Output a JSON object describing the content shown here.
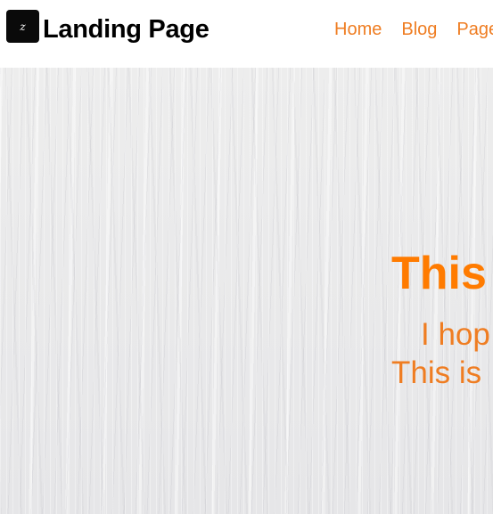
{
  "header": {
    "logo_glyph": "z",
    "brand": "Landing Page",
    "nav": [
      "Home",
      "Blog",
      "Page"
    ]
  },
  "hero": {
    "title": "This",
    "line1": "I hop",
    "line2": "This is"
  },
  "colors": {
    "accent": "#ff7b00",
    "nav_link": "#ef7d22"
  }
}
